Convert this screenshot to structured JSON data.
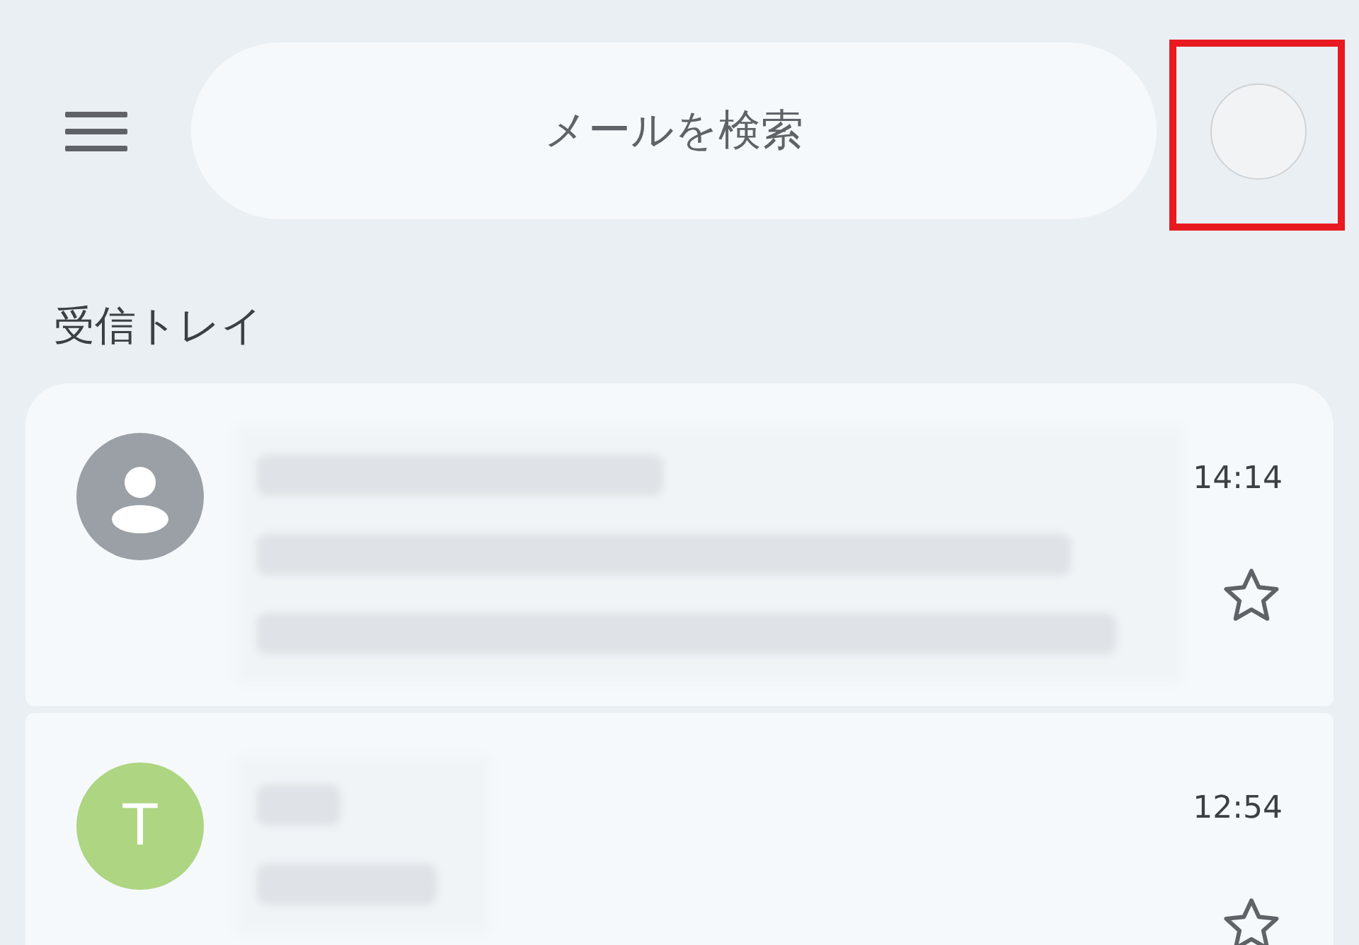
{
  "search": {
    "placeholder": "メールを検索"
  },
  "account": {
    "highlighted": true
  },
  "section_title": "受信トレイ",
  "messages": [
    {
      "avatar": {
        "kind": "person"
      },
      "time": "14:14",
      "starred": false
    },
    {
      "avatar": {
        "kind": "letter",
        "letter": "T",
        "color": "#aed581"
      },
      "time": "12:54",
      "starred": false
    }
  ]
}
